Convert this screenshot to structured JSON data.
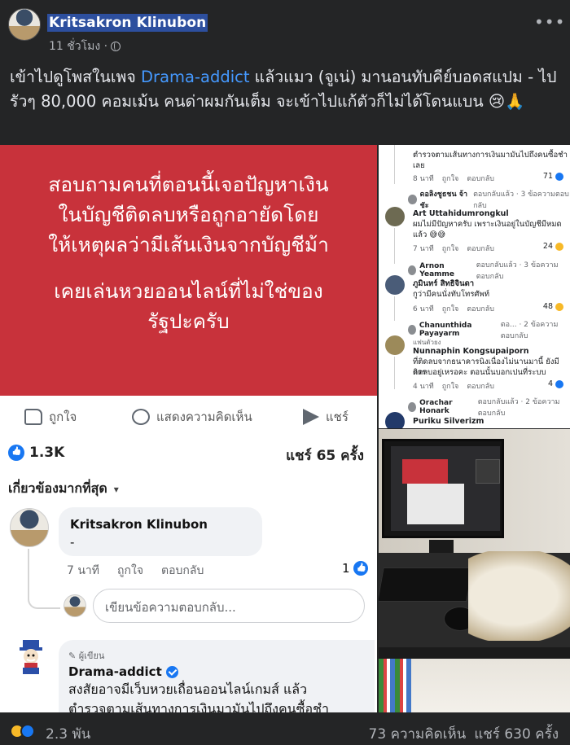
{
  "post": {
    "author": "Kritsakron Klinubon",
    "time": "11 ชั่วโมง ·",
    "text_before": "เข้าไปดูโพสในเพจ ",
    "page_link": "Drama-addict",
    "text_after": " แล้วแมว (จูเน่) มานอนทับคีย์บอดสแปม - ไปรัวๆ 80,000 คอมเม้น คนด่าผมกันเต็ม จะเข้าไปแก้ตัวก็ไม่ได้โดนแบน 😢🙏"
  },
  "left_screenshot": {
    "banner_lines": [
      "สอบถามคนที่ตอนนี้เจอปัญหาเงิน",
      "ในบัญชีติดลบหรือถูกอายัดโดย",
      "ให้เหตุผลว่ามีเส้นเงินจากบัญชีม้า",
      "",
      "เคยเล่นหวยออนไลน์ที่ไม่ใช่ของ",
      "รัฐปะครับ"
    ],
    "actions": {
      "like": "ถูกใจ",
      "comment": "แสดงความคิดเห็น",
      "share": "แชร์"
    },
    "reaction_count": "1.3K",
    "share_count": "แชร์ 65 ครั้ง",
    "sort_label": "เกี่ยวข้องมากที่สุด",
    "comment": {
      "name": "Kritsakron Klinubon",
      "text": "-",
      "time": "7 นาที",
      "like": "ถูกใจ",
      "reply": "ตอบกลับ",
      "count": "1"
    },
    "reply_placeholder": "เขียนข้อความตอบกลับ...",
    "da_comment": {
      "badge": "ผู้เขียน",
      "name": "Drama-addict",
      "text1": "สงสัยอาจมีเว็บหวยเถื่อนออนไลน์เกมส์ แล้ว",
      "text2": "ตำรวจตามเส้นทางการเงินมามันไปถึงคนซื้อชำ"
    }
  },
  "right_screenshot": {
    "items": [
      {
        "text": "ตำรวจตามเส้นทางการเงินมามันไปถึงคนซื้อชำ",
        "text2": "เลย",
        "time": "8 นาที",
        "like": "ถูกใจ",
        "reply": "ตอบกลับ",
        "count": "71"
      },
      {
        "reply_name": "ดอลิงชูธชน จ้าชัะ",
        "reply_text": "ตอบกลับแล้ว · 3 ข้อความตอบกลับ"
      },
      {
        "name": "Art Uttahidumrongkul",
        "text": "ผมไม่มีปัญหาครับ เพราะเงินอยู่ในบัญชีมีหมด",
        "text2": "แล้ว 😅😅",
        "time": "7 นาที",
        "like": "ถูกใจ",
        "reply": "ตอบกลับ",
        "count": "24"
      },
      {
        "reply_name": "Arnon Yeamme",
        "reply_text": "ตอบกลับแล้ว · 3 ข้อความตอบกลับ"
      },
      {
        "name": "ภูมินทร์ สิทธิจินดา",
        "text": "กูว่ามีคนนั่งทับโทรศัพท์",
        "time": "6 นาที",
        "like": "ถูกใจ",
        "reply": "ตอบกลับ",
        "count": "48"
      },
      {
        "reply_name": "Chanunthida Payayarm",
        "reply_text": "ตอ... · 2 ข้อความตอบกลับ"
      },
      {
        "badge": "แฟนตัวยง",
        "name": "Nunnaphin Kongsupaiporn",
        "text": "ที่ติดลบจากธนาคารนิงเนื่องไม่นานมานี้ ยังมีการ",
        "text2": "ติดลบอยู่เหรอคะ ตอนนั้นบอกเปนที่ระบบ",
        "time": "4 นาที",
        "like": "ถูกใจ",
        "reply": "ตอบกลับ",
        "count": "4"
      },
      {
        "reply_name": "Orachar Honark",
        "reply_text": "ตอบกลับแล้ว · 2 ข้อความตอบกลับ"
      },
      {
        "name": "Puriku Silverizm"
      }
    ]
  },
  "footer": {
    "reaction_count": "2.3 พัน",
    "comments": "73 ความคิดเห็น",
    "shares": "แชร์ 630 ครั้ง"
  },
  "colors": {
    "background": "#242526",
    "link": "#4599ff",
    "banner_red": "#c8323b",
    "fb_blue": "#1877f2"
  },
  "icons": [
    "globe-icon",
    "more-icon",
    "like-icon",
    "comment-icon",
    "share-icon",
    "verified-icon",
    "haha-reaction-icon",
    "like-reaction-icon"
  ]
}
